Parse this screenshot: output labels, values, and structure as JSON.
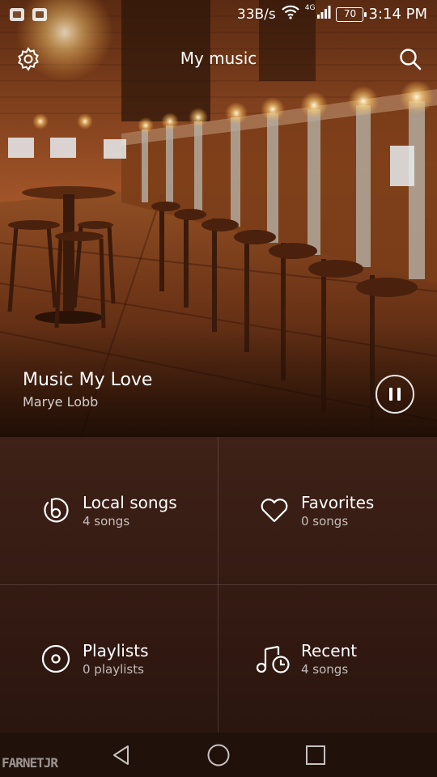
{
  "status_bar": {
    "net_speed": "33B/s",
    "network_type": "4G",
    "battery": "70",
    "time": "3:14 PM",
    "icons": [
      "photo-notification-icon",
      "gallery-notification-icon",
      "wifi-icon",
      "signal-icon",
      "battery-icon"
    ]
  },
  "app_bar": {
    "title": "My music",
    "settings_icon": "gear-icon",
    "search_icon": "search-icon"
  },
  "now_playing": {
    "title": "Music My Love",
    "artist": "Marye Lobb",
    "control_icon": "pause-icon"
  },
  "tiles": [
    {
      "label": "Local songs",
      "count": "4 songs",
      "icon": "local-songs-icon"
    },
    {
      "label": "Favorites",
      "count": "0 songs",
      "icon": "heart-icon"
    },
    {
      "label": "Playlists",
      "count": "0 playlists",
      "icon": "disc-icon"
    },
    {
      "label": "Recent",
      "count": "4 songs",
      "icon": "music-clock-icon"
    }
  ],
  "nav_bar": {
    "icons": [
      "back-icon",
      "home-icon",
      "recents-icon"
    ]
  },
  "watermark": "FARNETJR",
  "colors": {
    "accent": "#ffffff",
    "background": "#2a150f",
    "scene_warm": "#8a4a1d"
  }
}
